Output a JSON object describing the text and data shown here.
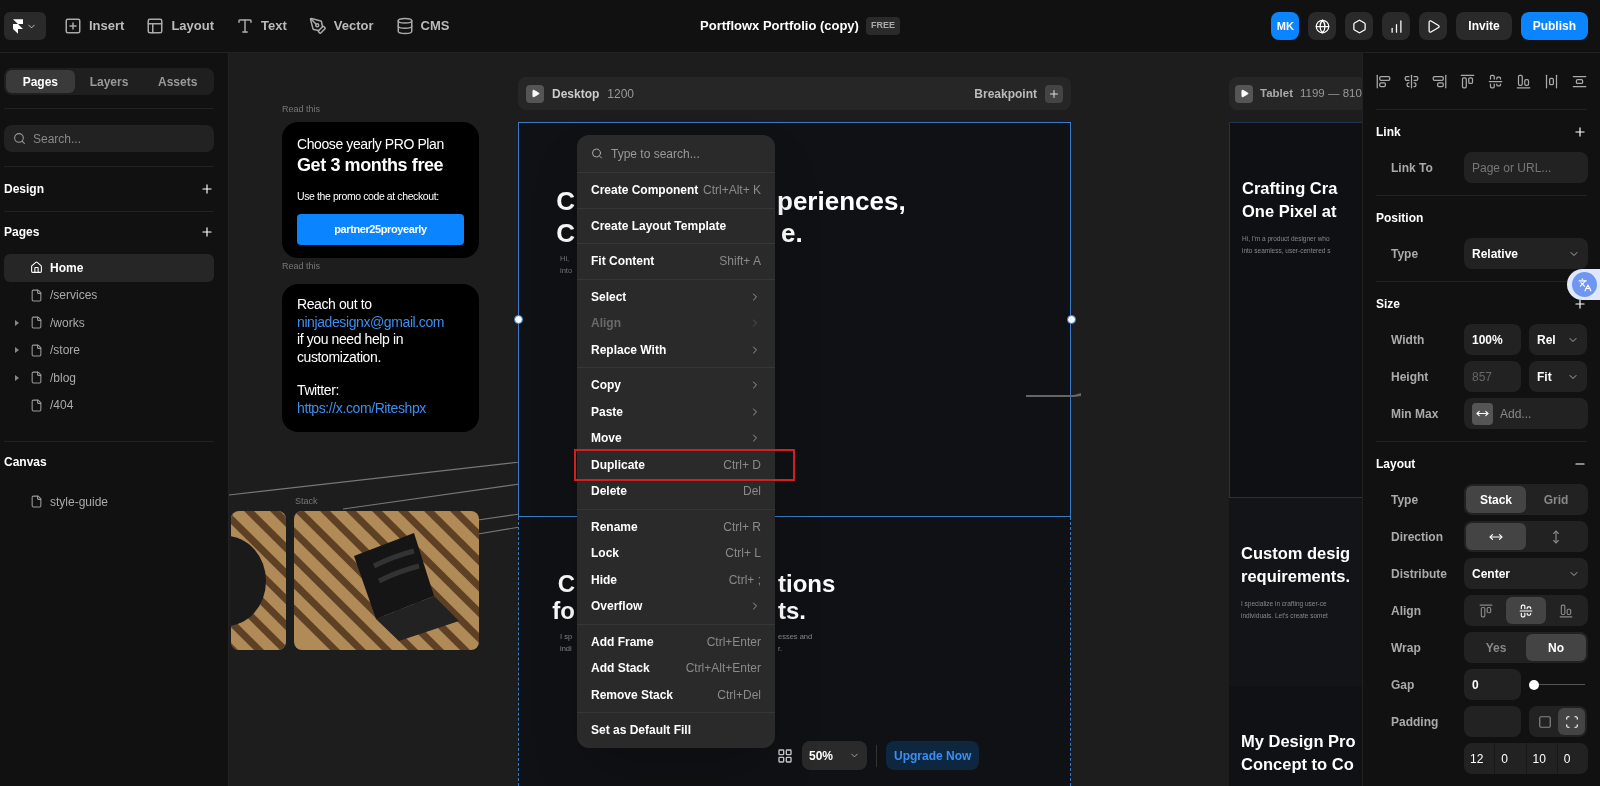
{
  "top_bar": {
    "tools": [
      {
        "label": "Insert"
      },
      {
        "label": "Layout"
      },
      {
        "label": "Text"
      },
      {
        "label": "Vector"
      },
      {
        "label": "CMS"
      }
    ],
    "title": "Portflowx Portfolio (copy)",
    "plan": "FREE",
    "avatar": "MK",
    "buttons": [
      {
        "label": "Invite",
        "kind": "secondary"
      },
      {
        "label": "Publish",
        "kind": "primary"
      }
    ]
  },
  "sidebar": {
    "tabs": [
      {
        "label": "Pages",
        "selected": true
      },
      {
        "label": "Layers",
        "selected": false
      },
      {
        "label": "Assets",
        "selected": false
      }
    ],
    "search": {
      "placeholder": "Search..."
    },
    "sections": [
      {
        "title": "Design",
        "can_add": true
      },
      {
        "title": "Pages",
        "can_add": true,
        "items": [
          {
            "label": "Home",
            "kind": "home",
            "expandable": false,
            "selected": true
          },
          {
            "label": "/services",
            "kind": "page",
            "expandable": false,
            "selected": false
          },
          {
            "label": "/works",
            "kind": "page",
            "expandable": true,
            "selected": false
          },
          {
            "label": "/store",
            "kind": "page",
            "expandable": true,
            "selected": false
          },
          {
            "label": "/blog",
            "kind": "page",
            "expandable": true,
            "selected": false
          },
          {
            "label": "/404",
            "kind": "page",
            "expandable": false,
            "selected": false
          }
        ]
      },
      {
        "title": "Canvas",
        "can_add": false,
        "items": [
          {
            "label": "style-guide",
            "kind": "page",
            "expandable": false,
            "selected": false
          }
        ]
      }
    ]
  },
  "canvas": {
    "promo_card": {
      "caption": "Read this",
      "subtitle": "Choose yearly PRO Plan",
      "headline": "Get 3 months free",
      "instruction": "Use the promo code at checkout:",
      "code": "partner25proyearly"
    },
    "contact_card": {
      "caption": "Read this",
      "paragraphs": [
        {
          "text": "Reach out to",
          "link": "ninjadesignx@gmail.com",
          "after": "if you need help in customization."
        },
        {
          "text": "Twitter:",
          "link": "https://x.com/Riteshpx"
        }
      ]
    },
    "stack": {
      "caption": "Stack"
    },
    "desktop": {
      "label": "Desktop",
      "size": "1200",
      "action": "Breakpoint",
      "selected": true,
      "hero": {
        "heading_left": [
          "C",
          "C"
        ],
        "heading_right": [
          "periences,",
          "e."
        ],
        "body_left": [
          "Hi,",
          "into"
        ]
      },
      "section": {
        "heading_left": [
          "C",
          "fo"
        ],
        "heading_right": [
          "tions",
          "ts."
        ],
        "body_left": [
          "I sp",
          "indi"
        ],
        "body_right": [
          "esses and",
          "r."
        ]
      },
      "zoom": "50%",
      "upgrade": "Upgrade Now"
    },
    "tablet": {
      "label": "Tablet",
      "size": "1199 — 810",
      "sections": [
        {
          "heading": [
            "Crafting Cra",
            "One Pixel at"
          ],
          "body": [
            "Hi, I'm a product designer who",
            "into seamless, user-centered s"
          ]
        },
        {
          "heading": [
            "Custom desig",
            "requirements."
          ],
          "body": [
            "I specialize in crafting user-ce",
            "individuals. Let's create somet"
          ]
        },
        {
          "heading": [
            "My Design Pro",
            "Concept to Co"
          ]
        }
      ]
    }
  },
  "context_menu": {
    "search_placeholder": "Type to search...",
    "groups": [
      [
        {
          "label": "Create Component",
          "shortcut": "Ctrl+Alt+ K",
          "submenu": false,
          "disabled": false,
          "annotated": false
        }
      ],
      [
        {
          "label": "Create Layout Template",
          "submenu": false,
          "disabled": false,
          "annotated": false
        }
      ],
      [
        {
          "label": "Fit Content",
          "shortcut": "Shift+ A",
          "submenu": false,
          "disabled": false,
          "annotated": false
        }
      ],
      [
        {
          "label": "Select",
          "submenu": true,
          "disabled": false,
          "annotated": false
        },
        {
          "label": "Align",
          "submenu": true,
          "disabled": true,
          "annotated": false
        },
        {
          "label": "Replace With",
          "submenu": true,
          "disabled": false,
          "annotated": false
        }
      ],
      [
        {
          "label": "Copy",
          "submenu": true,
          "disabled": false,
          "annotated": false
        },
        {
          "label": "Paste",
          "submenu": true,
          "disabled": false,
          "annotated": false
        },
        {
          "label": "Move",
          "submenu": true,
          "disabled": false,
          "annotated": false
        },
        {
          "label": "Duplicate",
          "shortcut": "Ctrl+ D",
          "submenu": false,
          "disabled": false,
          "annotated": true
        },
        {
          "label": "Delete",
          "shortcut": "Del",
          "submenu": false,
          "disabled": false,
          "annotated": false
        }
      ],
      [
        {
          "label": "Rename",
          "shortcut": "Ctrl+ R",
          "submenu": false,
          "disabled": false,
          "annotated": false
        },
        {
          "label": "Lock",
          "shortcut": "Ctrl+ L",
          "submenu": false,
          "disabled": false,
          "annotated": false
        },
        {
          "label": "Hide",
          "shortcut": "Ctrl+ ;",
          "submenu": false,
          "disabled": false,
          "annotated": false
        },
        {
          "label": "Overflow",
          "submenu": true,
          "disabled": false,
          "annotated": false
        }
      ],
      [
        {
          "label": "Add Frame",
          "shortcut": "Ctrl+Enter",
          "submenu": false,
          "disabled": false,
          "annotated": false
        },
        {
          "label": "Add Stack",
          "shortcut": "Ctrl+Alt+Enter",
          "submenu": false,
          "disabled": false,
          "annotated": false
        },
        {
          "label": "Remove Stack",
          "shortcut": "Ctrl+Del",
          "submenu": false,
          "disabled": false,
          "annotated": false
        }
      ],
      [
        {
          "label": "Set as Default Fill",
          "submenu": false,
          "disabled": false,
          "annotated": false
        }
      ]
    ]
  },
  "inspector": {
    "sections": [
      {
        "title": "Link",
        "can_add": true,
        "collapsible": false,
        "rows": [
          {
            "kind": "input",
            "label": "Link To",
            "placeholder": "Page or URL..."
          }
        ]
      },
      {
        "title": "Position",
        "can_add": false,
        "collapsible": false,
        "rows": [
          {
            "kind": "select",
            "label": "Type",
            "value": "Relative"
          }
        ]
      },
      {
        "title": "Size",
        "can_add": true,
        "collapsible": false,
        "rows": [
          {
            "kind": "input_select",
            "label": "Width",
            "value": "100%",
            "unit": "Rel"
          },
          {
            "kind": "input_select",
            "label": "Height",
            "placeholder": "857",
            "unit": "Fit"
          },
          {
            "kind": "minmax",
            "label": "Min Max",
            "placeholder": "Add..."
          }
        ]
      },
      {
        "title": "Layout",
        "can_add": false,
        "collapsible": true,
        "rows": [
          {
            "kind": "segmented",
            "label": "Type",
            "options": [
              {
                "label": "Stack",
                "selected": true
              },
              {
                "label": "Grid",
                "selected": false
              }
            ]
          },
          {
            "kind": "icon_segmented",
            "label": "Direction",
            "options": [
              {
                "selected": true
              },
              {
                "selected": false
              }
            ]
          },
          {
            "kind": "select",
            "label": "Distribute",
            "value": "Center"
          },
          {
            "kind": "icon_segmented",
            "label": "Align",
            "options": [
              {
                "selected": false
              },
              {
                "selected": true
              },
              {
                "selected": false
              }
            ]
          },
          {
            "kind": "segmented",
            "label": "Wrap",
            "options": [
              {
                "label": "Yes",
                "selected": false
              },
              {
                "label": "No",
                "selected": true
              }
            ]
          },
          {
            "kind": "slider",
            "label": "Gap",
            "value": "0",
            "level": 0
          },
          {
            "kind": "padding",
            "label": "Padding",
            "options": [
              {
                "selected": false
              },
              {
                "selected": true
              }
            ]
          },
          {
            "kind": "sides",
            "values": [
              "12",
              "0",
              "10",
              "0"
            ]
          }
        ]
      }
    ]
  }
}
